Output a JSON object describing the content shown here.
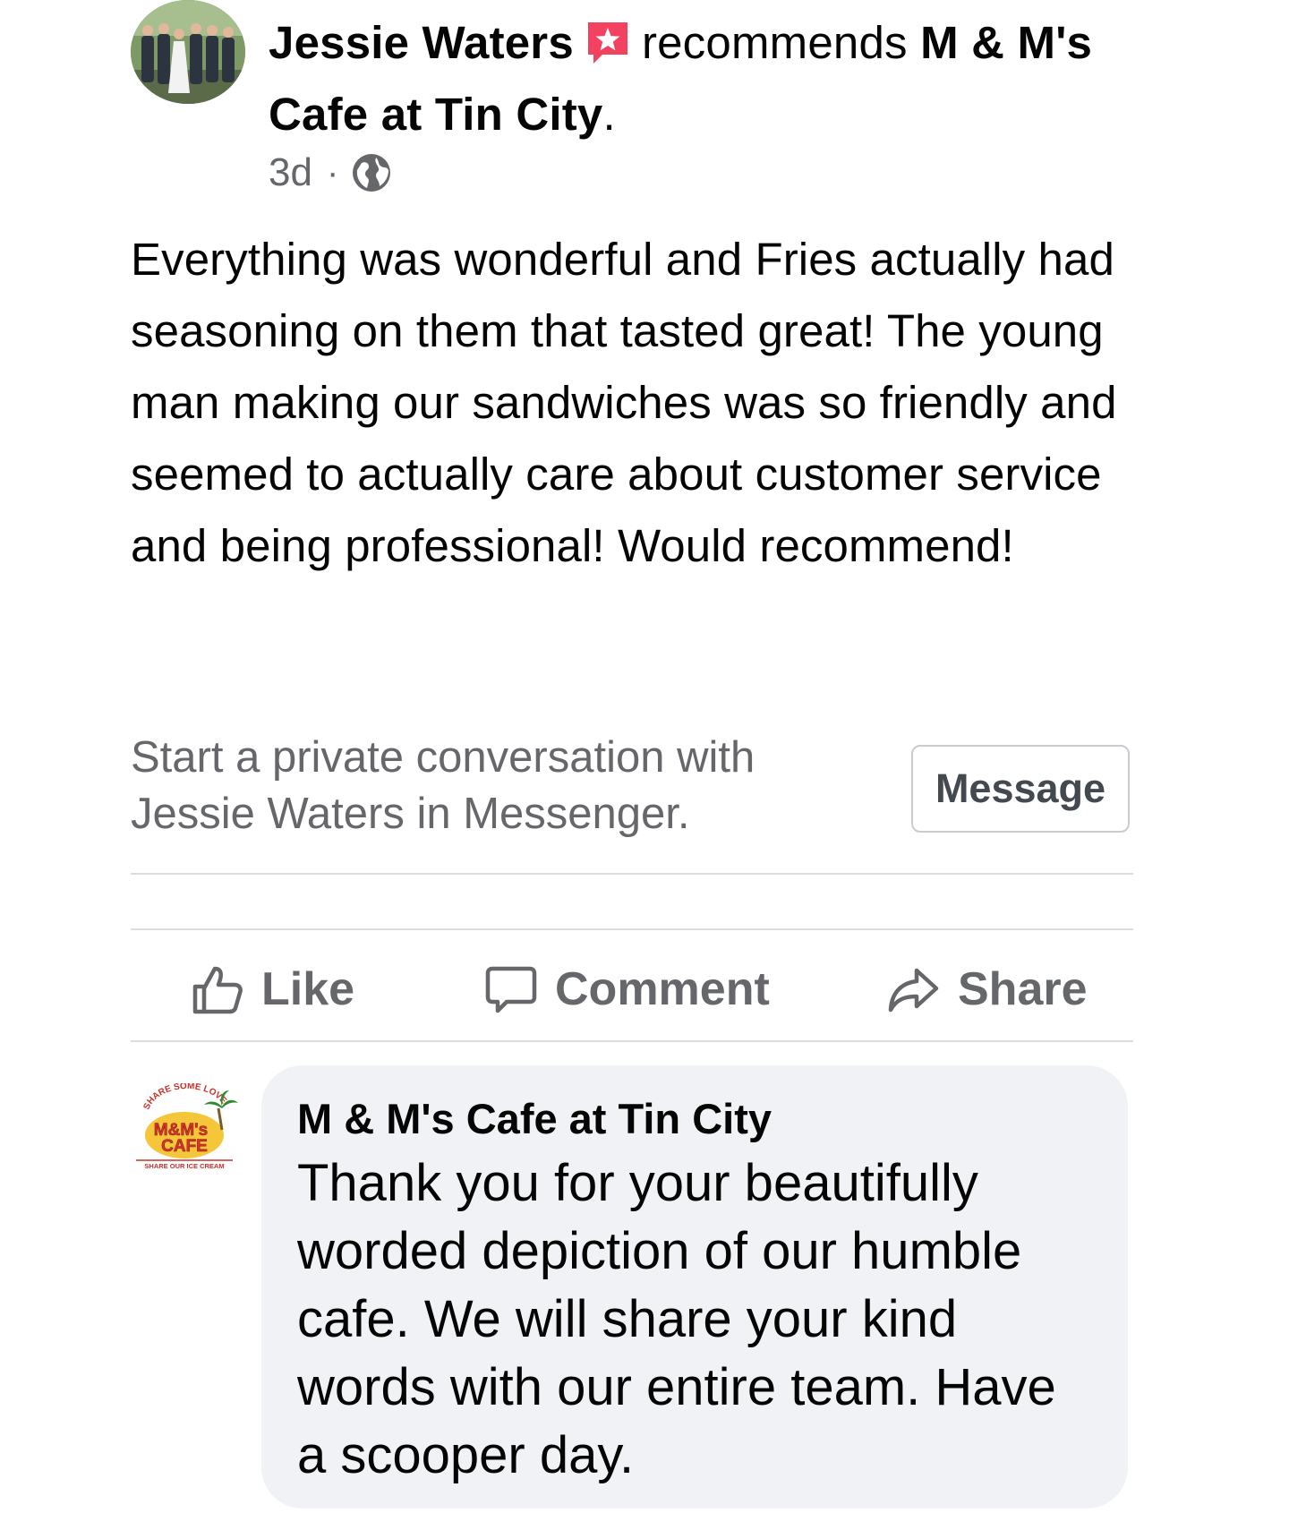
{
  "post": {
    "author": "Jessie Waters",
    "action_text": "recommends",
    "page_name_line": "M & M's Cafe at Tin City",
    "page_name_period": ".",
    "time": "3d",
    "dot": "·",
    "audience_icon": "globe-icon",
    "badge_icon": "recommendation-star-icon",
    "body": "Everything was wonderful and Fries actually had seasoning on them that tasted great! The young man making our sandwiches was so friendly and seemed to actually care about customer service and being professional! Would recommend!"
  },
  "messenger_prompt": {
    "text_line1": "Start a private conversation with",
    "text_line2": "Jessie Waters in Messenger.",
    "button_label": "Message"
  },
  "actions": {
    "like_label": "Like",
    "comment_label": "Comment",
    "share_label": "Share"
  },
  "comment": {
    "author": "M & M's Cafe at Tin City",
    "text": "Thank you for your beautifully worded depiction of our humble cafe. We will share your kind words with our entire team. Have a scooper day.",
    "logo_lines": {
      "top_arc": "SHARE SOME LOVE",
      "name_line1": "M&M's",
      "name_line2": "CAFE",
      "bottom_line": "SHARE OUR ICE CREAM"
    }
  },
  "colors": {
    "text_primary": "#050505",
    "text_secondary": "#65676b",
    "divider": "#dadde1",
    "bubble_bg": "#f0f2f5",
    "badge_red": "#f3425f"
  }
}
